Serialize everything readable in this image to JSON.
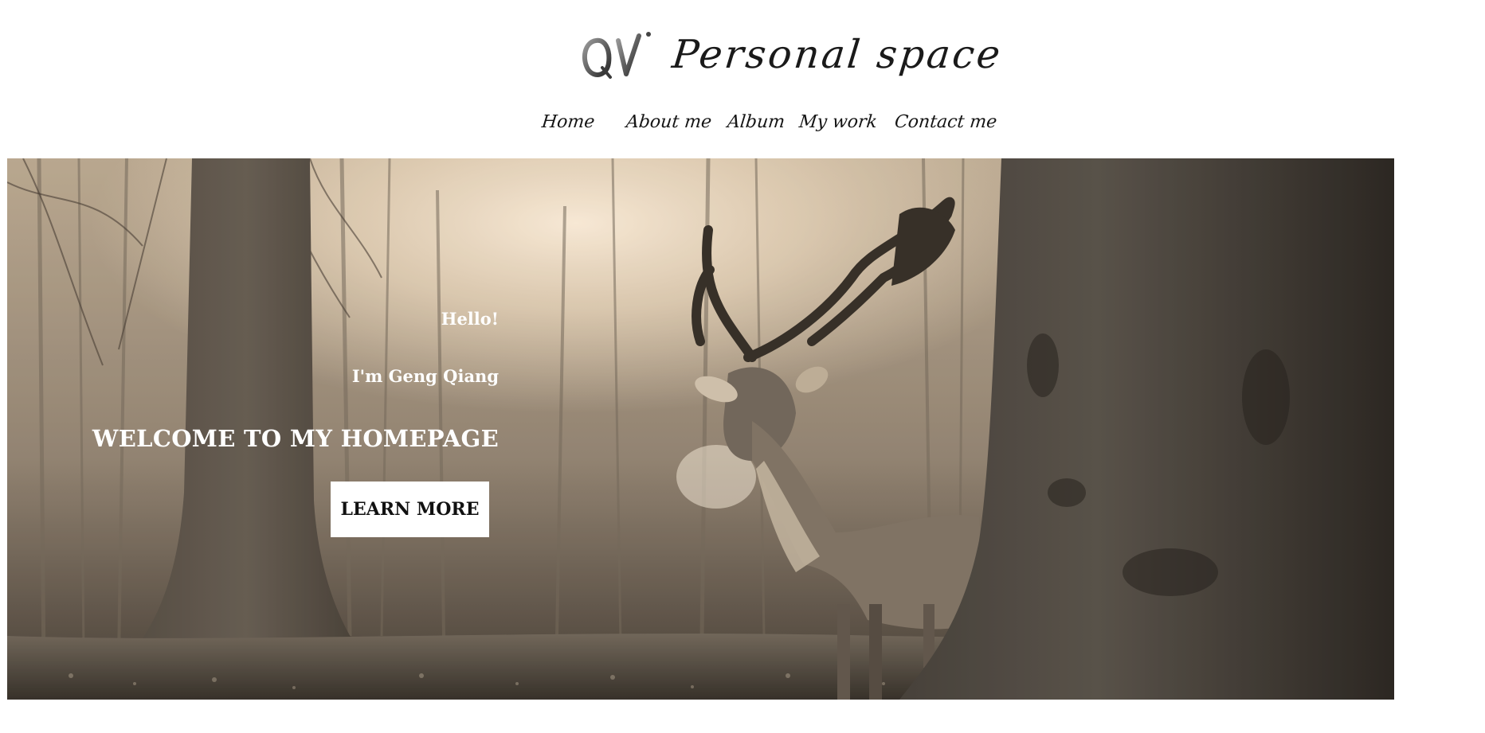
{
  "header": {
    "brand_title": "Personal space"
  },
  "nav": {
    "items": [
      {
        "label": "Home"
      },
      {
        "label": "About me"
      },
      {
        "label": "Album"
      },
      {
        "label": "My work"
      },
      {
        "label": "Contact me"
      }
    ]
  },
  "hero": {
    "greeting": "Hello!",
    "name_line": "I'm Geng Qiang",
    "welcome": "WELCOME TO MY HOMEPAGE",
    "button_label": "LEARN MORE"
  },
  "colors": {
    "hero_text": "#ffffff",
    "button_bg": "#ffffff",
    "header_text": "#1a1a1a",
    "photo_tone": "#d9c6a8"
  },
  "icons": {
    "logo": "qv-logo-icon",
    "hero_image": "deer-forest-photo"
  }
}
